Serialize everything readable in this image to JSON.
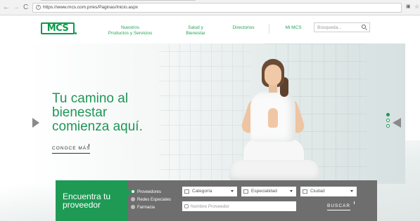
{
  "browser": {
    "back_icon": "←",
    "forward_icon": "→",
    "reload_icon": "C",
    "info_icon": "i",
    "url": "https://www.mcs.com.pr/es/Paginas/Inicio.aspx",
    "extension_icon": "▣",
    "star_icon": "☆"
  },
  "header": {
    "logo_text": "MCS",
    "nav": [
      {
        "line1": "Nuestros",
        "line2": "Productos y Servicios"
      },
      {
        "line1": "Salud y",
        "line2": "Bienestar"
      },
      {
        "line1": "Directorios",
        "line2": ""
      },
      {
        "line1": "Mi MCS",
        "line2": ""
      }
    ],
    "search_placeholder": "Búsqueda..."
  },
  "hero": {
    "headline": [
      "Tu camino al",
      "bienestar",
      "comienza aquí."
    ],
    "cta": "CONOCE MÁS",
    "slides_total": 3,
    "slide_active": 1
  },
  "provider": {
    "title": [
      "Encuentra tu",
      "proveedor"
    ],
    "options": [
      "Proveedores",
      "Redes Especiales",
      "Farmacia"
    ],
    "selected_option": "Proveedores",
    "selects": [
      "Categoría",
      "Especialidad",
      "Ciudad"
    ],
    "name_placeholder": "Nombre Proveedor",
    "search_button": "BUSCAR"
  },
  "colors": {
    "brand_green": "#1e9a55",
    "bar_gray": "#6e6e6e"
  }
}
